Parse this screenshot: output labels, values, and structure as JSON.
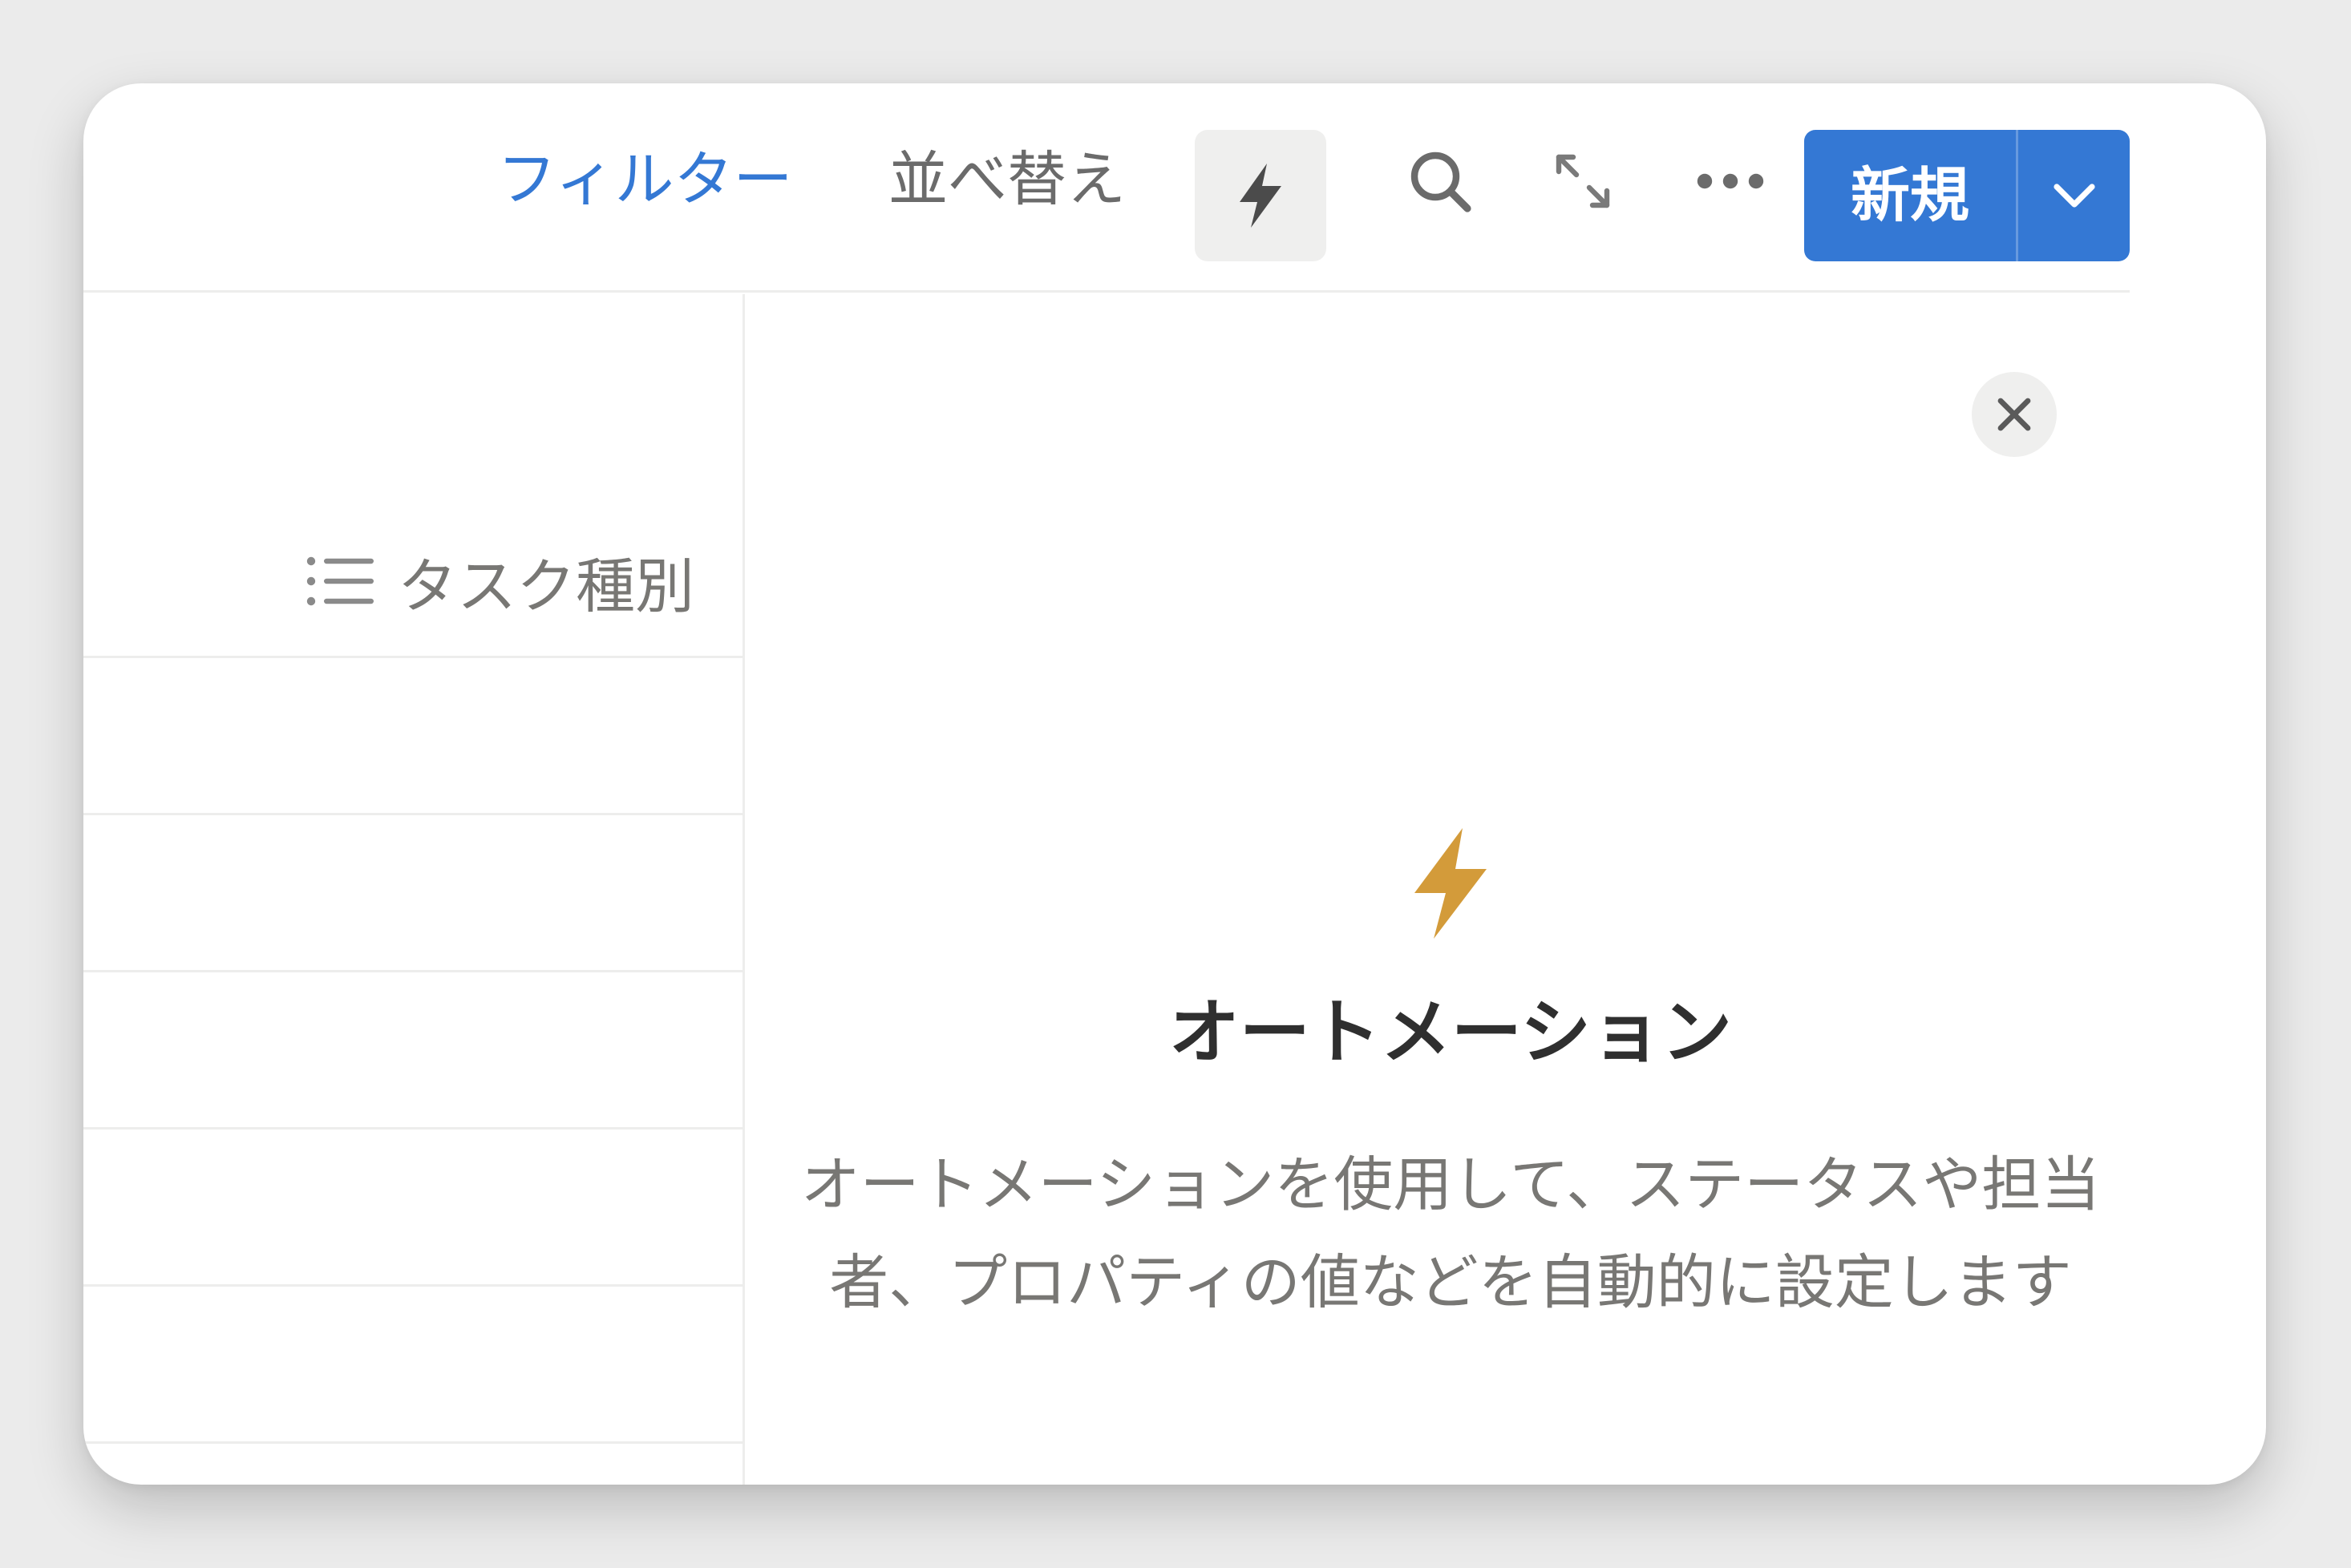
{
  "toolbar": {
    "filter_label": "フィルター",
    "sort_label": "並べ替え",
    "automation_icon": "bolt-icon",
    "search_icon": "search-icon",
    "expand_icon": "expand-icon",
    "more_icon": "more-horizontal-icon",
    "new_button_label": "新規",
    "new_dropdown_icon": "chevron-down-icon"
  },
  "table": {
    "column_header": {
      "icon": "list-icon",
      "label": "タスク種別"
    },
    "rows": [
      "",
      "",
      "",
      "",
      ""
    ]
  },
  "automation_panel": {
    "close_icon": "close-icon",
    "icon": "bolt-icon",
    "title": "オートメーション",
    "description": "オートメーションを使用して、ステータスや担当者、プロパティの値などを自動的に設定します"
  },
  "colors": {
    "accent_blue": "#3478d4",
    "bolt_gold": "#d39b3a",
    "muted_text": "#787774",
    "title_text": "#2f2f2f",
    "background": "#ebebeb",
    "card": "#ffffff"
  }
}
